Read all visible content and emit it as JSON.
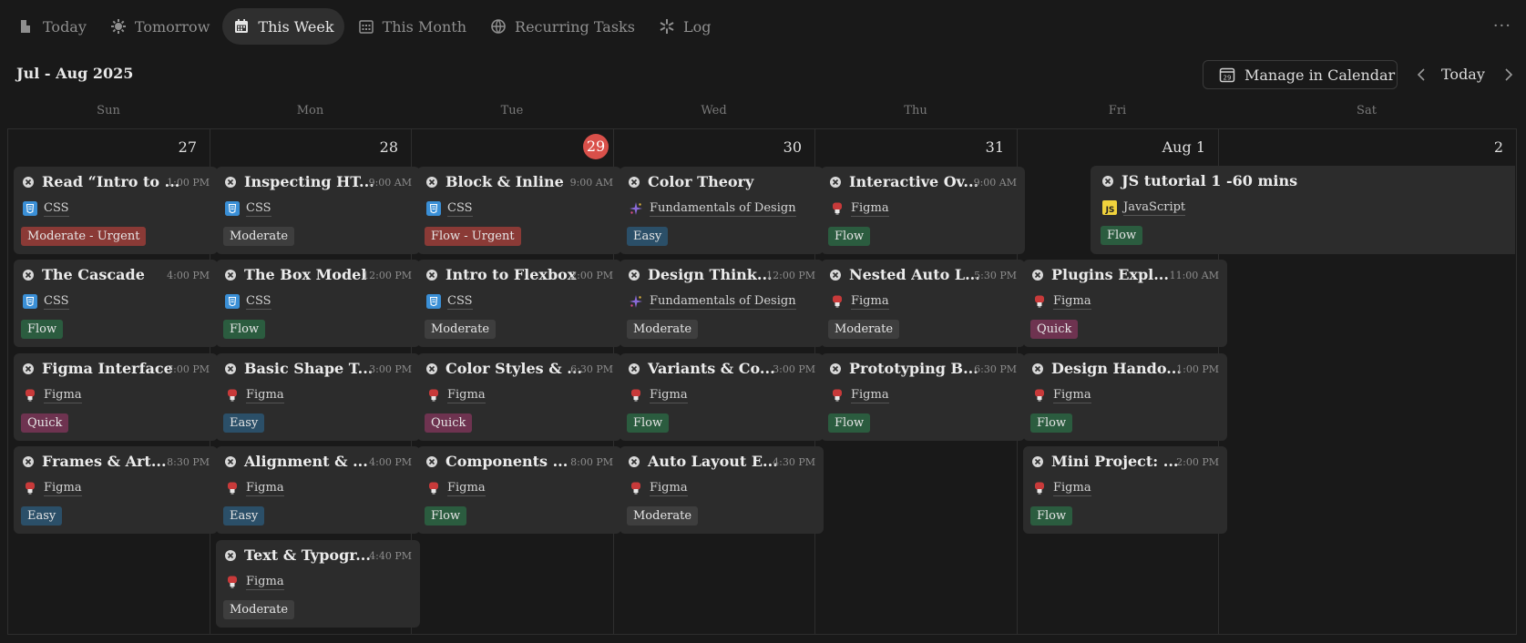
{
  "tabs": [
    {
      "label": "Today",
      "icon": "document-icon",
      "active": false
    },
    {
      "label": "Tomorrow",
      "icon": "sun-icon",
      "active": false
    },
    {
      "label": "This Week",
      "icon": "calendar-icon",
      "active": true
    },
    {
      "label": "This Month",
      "icon": "calendar-grid-icon",
      "active": false
    },
    {
      "label": "Recurring Tasks",
      "icon": "globe-icon",
      "active": false
    },
    {
      "label": "Log",
      "icon": "asterisk-icon",
      "active": false
    }
  ],
  "more_label": "···",
  "header": {
    "range": "Jul - Aug 2025",
    "manage_label": "Manage in Calendar",
    "calendar_icon_day": "29",
    "today_label": "Today"
  },
  "weekdays": [
    "Sun",
    "Mon",
    "Tue",
    "Wed",
    "Thu",
    "Fri",
    "Sat"
  ],
  "colors": {
    "Moderate - Urgent": "#8a3a36",
    "Moderate": "#3e3e3e",
    "Flow - Urgent": "#8a3a36",
    "Flow": "#2b5c3f",
    "Easy": "#2b4f68",
    "Quick": "#6e3350",
    "today_badge": "#d9504a"
  },
  "days": [
    {
      "num": "27",
      "today": false,
      "tasks": [
        {
          "title": "Read “Intro to ...",
          "time": "1:00 PM",
          "project": "CSS",
          "picon": "css-icon",
          "tag": "Moderate - Urgent"
        },
        {
          "title": "The Cascade",
          "time": "4:00 PM",
          "project": "CSS",
          "picon": "css-icon",
          "tag": "Flow"
        },
        {
          "title": "Figma Interface",
          "time": "7:00 PM",
          "project": "Figma",
          "picon": "figma-icon",
          "tag": "Quick"
        },
        {
          "title": "Frames & Art...",
          "time": "8:30 PM",
          "project": "Figma",
          "picon": "figma-icon",
          "tag": "Easy"
        }
      ]
    },
    {
      "num": "28",
      "today": false,
      "tasks": [
        {
          "title": "Inspecting HT...",
          "time": "9:00 AM",
          "project": "CSS",
          "picon": "css-icon",
          "tag": "Moderate"
        },
        {
          "title": "The Box Model",
          "time": "12:00 PM",
          "project": "CSS",
          "picon": "css-icon",
          "tag": "Flow"
        },
        {
          "title": "Basic Shape T...",
          "time": "3:00 PM",
          "project": "Figma",
          "picon": "figma-icon",
          "tag": "Easy"
        },
        {
          "title": "Alignment & ...",
          "time": "4:00 PM",
          "project": "Figma",
          "picon": "figma-icon",
          "tag": "Easy"
        },
        {
          "title": "Text & Typogr...",
          "time": "4:40 PM",
          "project": "Figma",
          "picon": "figma-icon",
          "tag": "Moderate"
        }
      ]
    },
    {
      "num": "29",
      "today": true,
      "tasks": [
        {
          "title": "Block & Inline",
          "time": "9:00 AM",
          "project": "CSS",
          "picon": "css-icon",
          "tag": "Flow - Urgent"
        },
        {
          "title": "Intro to Flexbox",
          "time": "2:00 PM",
          "project": "CSS",
          "picon": "css-icon",
          "tag": "Moderate"
        },
        {
          "title": "Color Styles & ...",
          "time": "6:30 PM",
          "project": "Figma",
          "picon": "figma-icon",
          "tag": "Quick"
        },
        {
          "title": "Components ...",
          "time": "8:00 PM",
          "project": "Figma",
          "picon": "figma-icon",
          "tag": "Flow"
        }
      ]
    },
    {
      "num": "30",
      "today": false,
      "tasks": [
        {
          "title": "Color Theory",
          "time": "",
          "project": "Fundamentals of Design",
          "picon": "sparkle-icon",
          "tag": "Easy"
        },
        {
          "title": "Design Think...",
          "time": "12:00 PM",
          "project": "Fundamentals of Design",
          "picon": "sparkle-icon",
          "tag": "Moderate"
        },
        {
          "title": "Variants & Co...",
          "time": "3:00 PM",
          "project": "Figma",
          "picon": "figma-icon",
          "tag": "Flow"
        },
        {
          "title": "Auto Layout E...",
          "time": "4:30 PM",
          "project": "Figma",
          "picon": "figma-icon",
          "tag": "Moderate"
        }
      ]
    },
    {
      "num": "31",
      "today": false,
      "tasks": [
        {
          "title": "Interactive Ov...",
          "time": "9:00 AM",
          "project": "Figma",
          "picon": "figma-icon",
          "tag": "Flow"
        },
        {
          "title": "Nested Auto L...",
          "time": "5:30 PM",
          "project": "Figma",
          "picon": "figma-icon",
          "tag": "Moderate"
        },
        {
          "title": "Prototyping B...",
          "time": "6:30 PM",
          "project": "Figma",
          "picon": "figma-icon",
          "tag": "Flow"
        }
      ]
    },
    {
      "num": "Aug 1",
      "today": false,
      "tasks": [
        {
          "title": "Plugins Expl...",
          "time": "11:00 AM",
          "project": "Figma",
          "picon": "figma-icon",
          "tag": "Quick"
        },
        {
          "title": "Design Hando...",
          "time": "1:00 PM",
          "project": "Figma",
          "picon": "figma-icon",
          "tag": "Flow"
        },
        {
          "title": "Mini Project: ...",
          "time": "2:00 PM",
          "project": "Figma",
          "picon": "figma-icon",
          "tag": "Flow"
        }
      ]
    },
    {
      "num": "2",
      "today": false,
      "tasks": []
    }
  ],
  "span_task": {
    "title": "JS tutorial 1 -60 mins",
    "project": "JavaScript",
    "picon": "javascript-icon",
    "tag": "Flow"
  }
}
